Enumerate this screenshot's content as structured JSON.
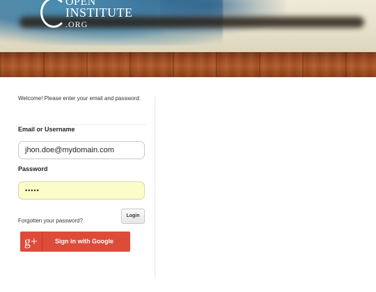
{
  "header": {
    "logo_line1": "OPEN",
    "logo_line2": "INSTITUTE",
    "logo_line3": ".ORG"
  },
  "form": {
    "welcome_text": "Welcome! Please enter your email and password:",
    "email_label": "Email or Username",
    "email_value": "jhon.doe@mydomain.com",
    "password_label": "Password",
    "password_value": "•••••",
    "forgot_link": "Forgotten your password?",
    "login_button": "Login",
    "google_icon_text": "g+",
    "google_button": "Sign in with Google"
  },
  "colors": {
    "google_red": "#dd4b39",
    "password_bg": "#fbfcc8",
    "wood": "#a44e22",
    "paint_blue": "#3c78a0"
  }
}
